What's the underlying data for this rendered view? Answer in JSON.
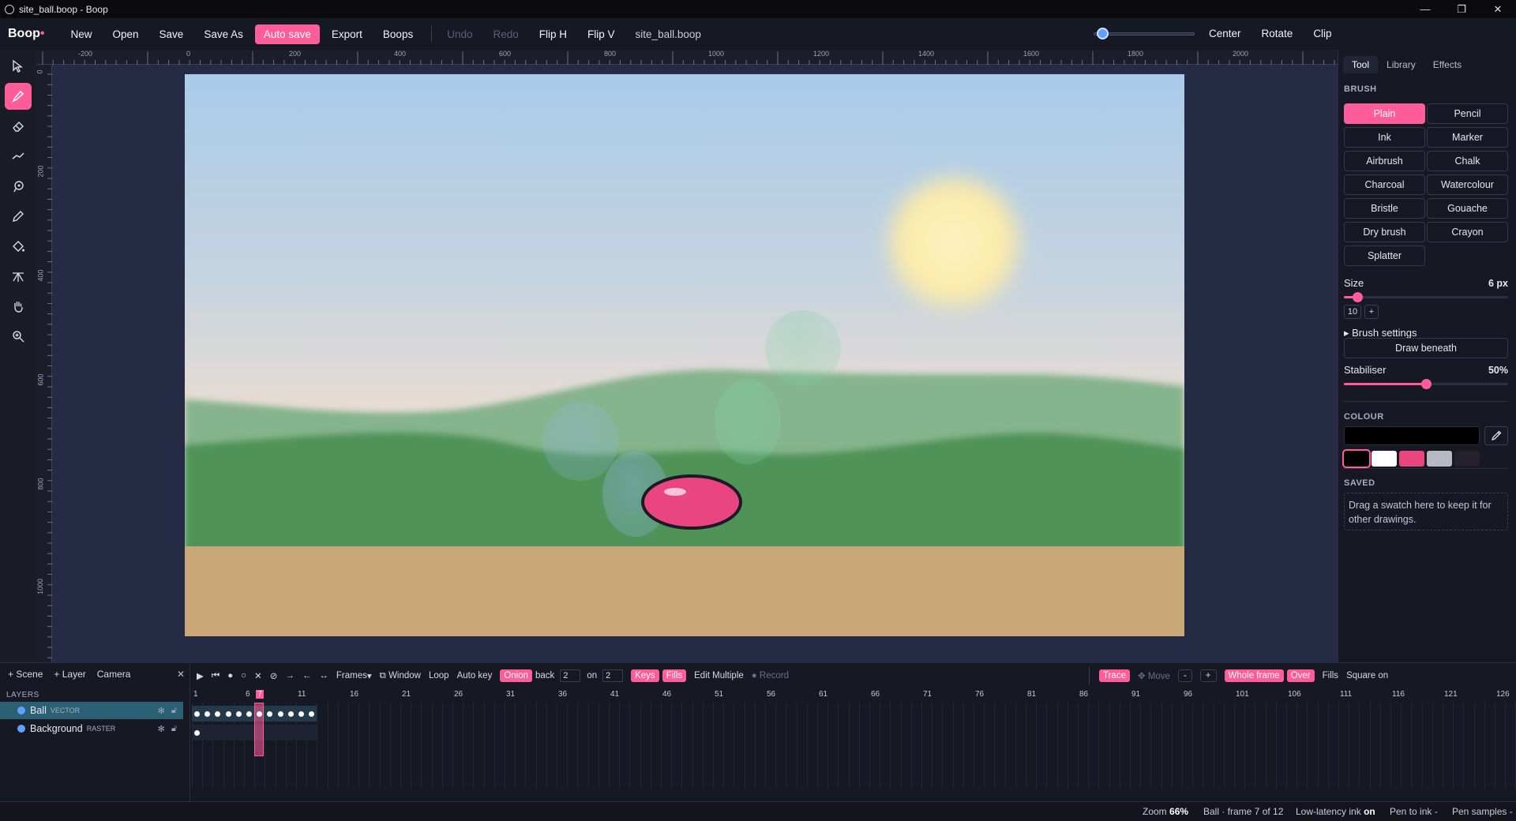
{
  "window": {
    "title": "site_ball.boop - Boop",
    "controls": [
      "—",
      "❐",
      "✕"
    ]
  },
  "menubar": {
    "logo": "Boop",
    "buttons": {
      "new": "New",
      "open": "Open",
      "save": "Save",
      "save_as": "Save As",
      "auto_save": "Auto save",
      "export": "Export",
      "boops": "Boops",
      "undo": "Undo",
      "redo": "Redo",
      "flip_h": "Flip H",
      "flip_v": "Flip V"
    },
    "filename": "site_ball.boop",
    "zoom_slider_fraction": 0.03,
    "right_buttons": {
      "center": "Center",
      "rotate": "Rotate",
      "clip": "Clip"
    }
  },
  "tools": [
    "select-arrow",
    "brush",
    "eraser",
    "line",
    "lasso",
    "pen",
    "fill-bucket",
    "symmetry",
    "hand",
    "zoom"
  ],
  "rulers": {
    "horizontal": [
      "-200",
      "0",
      "200",
      "400",
      "600",
      "800",
      "1000",
      "1200",
      "1400",
      "1600",
      "1800",
      "2000"
    ],
    "vertical": [
      "0",
      "200",
      "400",
      "600",
      "800",
      "1000"
    ]
  },
  "right_panel": {
    "tabs": {
      "tool": "Tool",
      "library": "Library",
      "effects": "Effects"
    },
    "brush_title": "BRUSH",
    "brushes": [
      "Plain",
      "Pencil",
      "Ink",
      "Marker",
      "Airbrush",
      "Chalk",
      "Charcoal",
      "Watercolour",
      "Bristle",
      "Gouache",
      "Dry brush",
      "Crayon",
      "Splatter"
    ],
    "active_brush": "Plain",
    "size_label": "Size",
    "size_value": "6 px",
    "size_fraction": 0.08,
    "size_input": "10",
    "size_plus": "+",
    "brush_settings": "▸ Brush settings",
    "draw_beneath": "Draw beneath",
    "stabiliser_label": "Stabiliser",
    "stabiliser_value": "50%",
    "stabiliser_fraction": 0.5,
    "colour_title": "COLOUR",
    "current_colour": "#000000",
    "swatches": [
      "#000000",
      "#ffffff",
      "#e9457e",
      "#b8b8c0",
      "#24212a"
    ],
    "saved_title": "SAVED",
    "saved_hint": "Drag a swatch here to keep it for other drawings."
  },
  "layers_panel": {
    "add_scene": "+ Scene",
    "add_layer": "+ Layer",
    "camera": "Camera",
    "close": "✕",
    "title": "LAYERS",
    "layers": [
      {
        "name": "Ball",
        "kind": "VECTOR"
      },
      {
        "name": "Background",
        "kind": "RASTER"
      }
    ]
  },
  "timeline": {
    "frames_label": "Frames",
    "window_label": "Window",
    "loop": "Loop",
    "auto_key": "Auto key",
    "onion": "Onion",
    "back_label": "back",
    "back_value": "2",
    "on_label": "on",
    "on_value": "2",
    "keys": "Keys",
    "fills": "Fills",
    "edit_multiple": "Edit Multiple",
    "record": "● Record",
    "trace": "Trace",
    "move": "✥ Move",
    "minus": "-",
    "plus": "+",
    "whole_frame": "Whole frame",
    "over": "Over",
    "fills2": "Fills",
    "square_on": "Square on",
    "frame_numbers": [
      "1",
      "6",
      "7",
      "11",
      "16",
      "21",
      "26",
      "31",
      "36",
      "41",
      "46",
      "51",
      "56",
      "61",
      "66",
      "71",
      "76",
      "81",
      "86",
      "91",
      "96",
      "101",
      "106",
      "111",
      "116",
      "121",
      "126"
    ],
    "current_frame": "7",
    "ball_keyframes": 12,
    "background_keyframes": 1
  },
  "statusbar": {
    "zoom_label": "Zoom",
    "zoom_value": "66%",
    "frame_info": "Ball · frame 7 of 12",
    "low_latency_label": "Low-latency ink",
    "low_latency_value": "on",
    "pen_to_ink": "Pen to ink -",
    "pen_samples": "Pen samples -"
  }
}
